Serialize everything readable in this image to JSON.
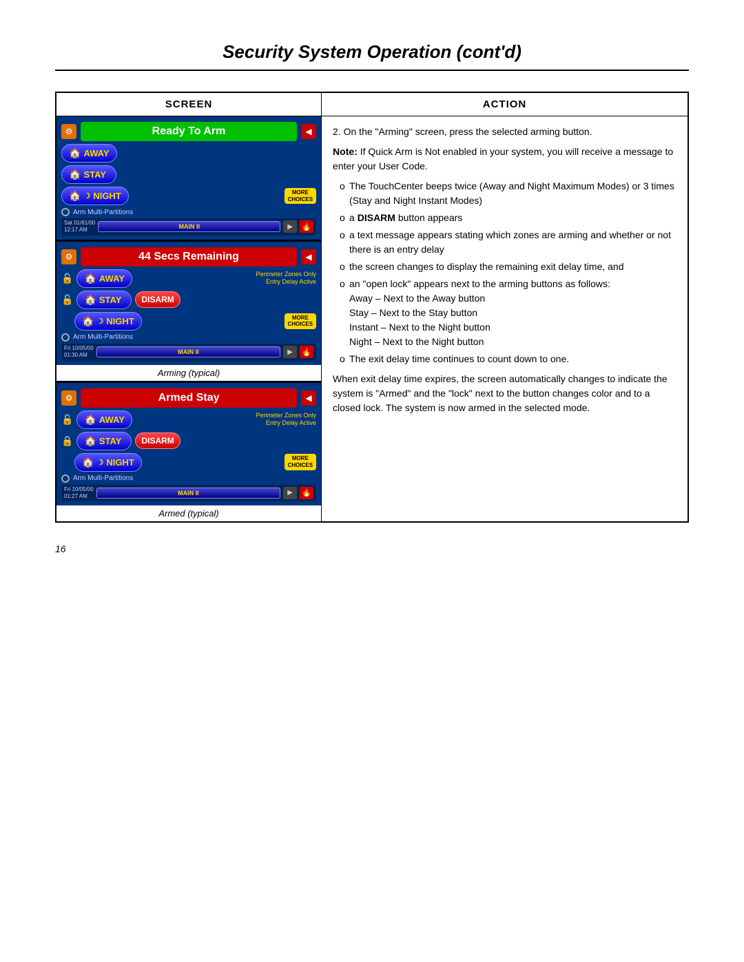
{
  "page": {
    "title": "Security System Operation (cont'd)",
    "page_number": "16"
  },
  "table": {
    "col_screen": "SCREEN",
    "col_action": "ACTION"
  },
  "panels": {
    "panel1": {
      "status": "Ready To Arm",
      "status_class": "status-ready",
      "datetime": "Sat 01/61/00\n12:17 AM",
      "main_label": "MAIN II",
      "buttons": {
        "away": "AWAY",
        "stay": "STAY",
        "night": "NIGHT"
      },
      "more_choices": "MORE\nCHOICES",
      "arm_multi": "Arm Multi-Partitions"
    },
    "panel2": {
      "status": "44  Secs Remaining",
      "status_class": "status-arming",
      "datetime": "Fri 10/05/00\n01:30 AM",
      "main_label": "MAIN II",
      "perimeter_label": "Perimeter Zones Only",
      "entry_delay_label": "Entry Delay Active",
      "buttons": {
        "away": "AWAY",
        "stay": "STAY",
        "night": "NIGHT",
        "disarm": "DISARM"
      },
      "more_choices": "MORE\nCHOICES",
      "arm_multi": "Arm Multi-Partitions",
      "panel_caption": "Arming (typical)"
    },
    "panel3": {
      "status": "Armed Stay",
      "status_class": "status-armed",
      "datetime": "Fri 10/05/00\n01:27 AM",
      "main_label": "MAIN II",
      "perimeter_label": "Perimeter Zones Only",
      "entry_delay_label": "Entry Delay Active",
      "buttons": {
        "away": "AWAY",
        "stay": "STAY",
        "night": "NIGHT",
        "disarm": "DISARM"
      },
      "more_choices": "MORE\nCHOICES",
      "arm_multi": "Arm Multi-Partitions",
      "panel_caption": "Armed (typical)"
    }
  },
  "action": {
    "step2": "2.  On the \"Arming\" screen, press the selected arming button.",
    "note_label": "Note:",
    "note_text": " If Quick Arm is Not enabled in your system, you will receive a message to enter your User Code.",
    "bullets": [
      "The TouchCenter beeps twice (Away and Night Maximum Modes) or 3 times (Stay and Night Instant Modes)",
      "a DISARM button appears",
      "a text message appears stating which zones are arming and whether or not there is an entry delay",
      "the screen changes to display the remaining exit delay time, and",
      "an \"open lock\" appears next to the arming buttons as follows:\nAway – Next to the Away button\nStay – Next to the Stay button\nInstant  – Next to the Night button\nNight – Next to the Night button",
      "The exit delay time continues to count down to one."
    ],
    "paragraph2": "When exit delay time expires, the screen automatically changes to indicate the system is \"Armed\" and the \"lock\" next to the button changes color and to a closed lock.  The system is now armed in the selected mode."
  }
}
